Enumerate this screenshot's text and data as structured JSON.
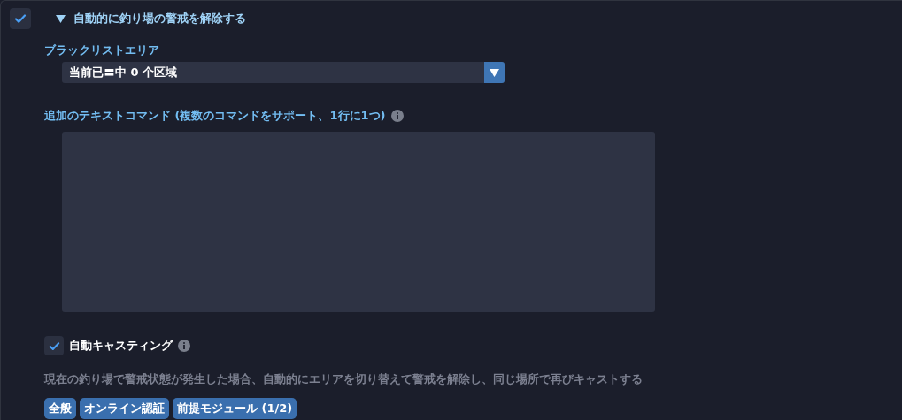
{
  "section": {
    "checked": true,
    "expanded": true,
    "title": "自動的に釣り場の警戒を解除する"
  },
  "blacklist": {
    "label": "ブラックリストエリア",
    "value": "当前已〓中 0 个区域"
  },
  "commands": {
    "label": "追加のテキストコマンド (複数のコマンドをサポート、1行に1つ)"
  },
  "auto_cast": {
    "checked": true,
    "label": "自動キャスティング",
    "description": "現在の釣り場で警戒状態が発生した場合、自動的にエリアを切り替えて警戒を解除し、同じ場所で再びキャストする"
  },
  "tags": [
    "全般",
    "オンライン認証",
    "前提モジュール (1/2)"
  ]
}
